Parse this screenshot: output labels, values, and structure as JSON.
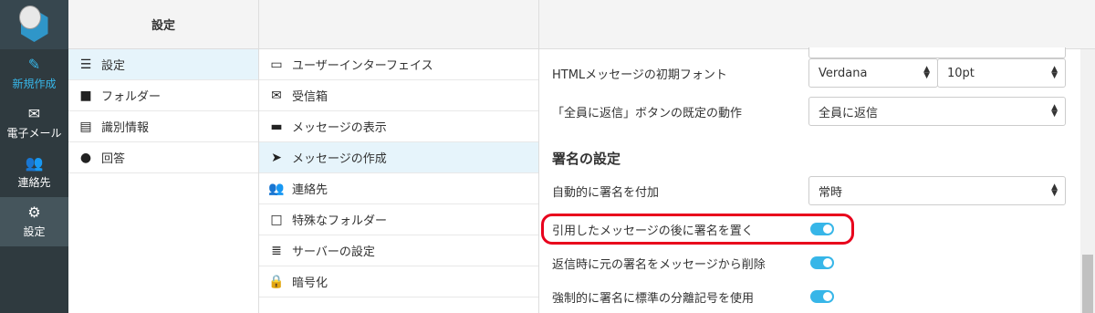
{
  "nav": {
    "items": [
      {
        "label": "新規作成",
        "icon": "compose-icon"
      },
      {
        "label": "電子メール",
        "icon": "mail-icon"
      },
      {
        "label": "連絡先",
        "icon": "contacts-icon"
      },
      {
        "label": "設定",
        "icon": "gear-icon"
      }
    ]
  },
  "col1": {
    "title": "設定",
    "items": [
      {
        "label": "設定",
        "icon": "sliders-icon"
      },
      {
        "label": "フォルダー",
        "icon": "folder-icon"
      },
      {
        "label": "識別情報",
        "icon": "id-card-icon"
      },
      {
        "label": "回答",
        "icon": "comment-icon"
      }
    ]
  },
  "col2": {
    "items": [
      {
        "label": "ユーザーインターフェイス",
        "icon": "monitor-icon"
      },
      {
        "label": "受信箱",
        "icon": "envelope-icon"
      },
      {
        "label": "メッセージの表示",
        "icon": "inbox-icon"
      },
      {
        "label": "メッセージの作成",
        "icon": "paper-plane-icon"
      },
      {
        "label": "連絡先",
        "icon": "users-icon"
      },
      {
        "label": "特殊なフォルダー",
        "icon": "folder-outline-icon"
      },
      {
        "label": "サーバーの設定",
        "icon": "server-icon"
      },
      {
        "label": "暗号化",
        "icon": "lock-icon"
      }
    ]
  },
  "settings": {
    "html_font_label": "HTMLメッセージの初期フォント",
    "font_value": "Verdana",
    "size_value": "10pt",
    "reply_all_label": "「全員に返信」ボタンの既定の動作",
    "reply_all_value": "全員に返信",
    "signature_section": "署名の設定",
    "auto_sig_label": "自動的に署名を付加",
    "auto_sig_value": "常時",
    "sig_below_quote_label": "引用したメッセージの後に署名を置く",
    "strip_sig_label": "返信時に元の署名をメッセージから削除",
    "force_sep_label": "強制的に署名に標準の分離記号を使用"
  },
  "colors": {
    "accent": "#37b6e8",
    "highlight": "#e8001c",
    "nav_bg": "#2f3a3f"
  }
}
